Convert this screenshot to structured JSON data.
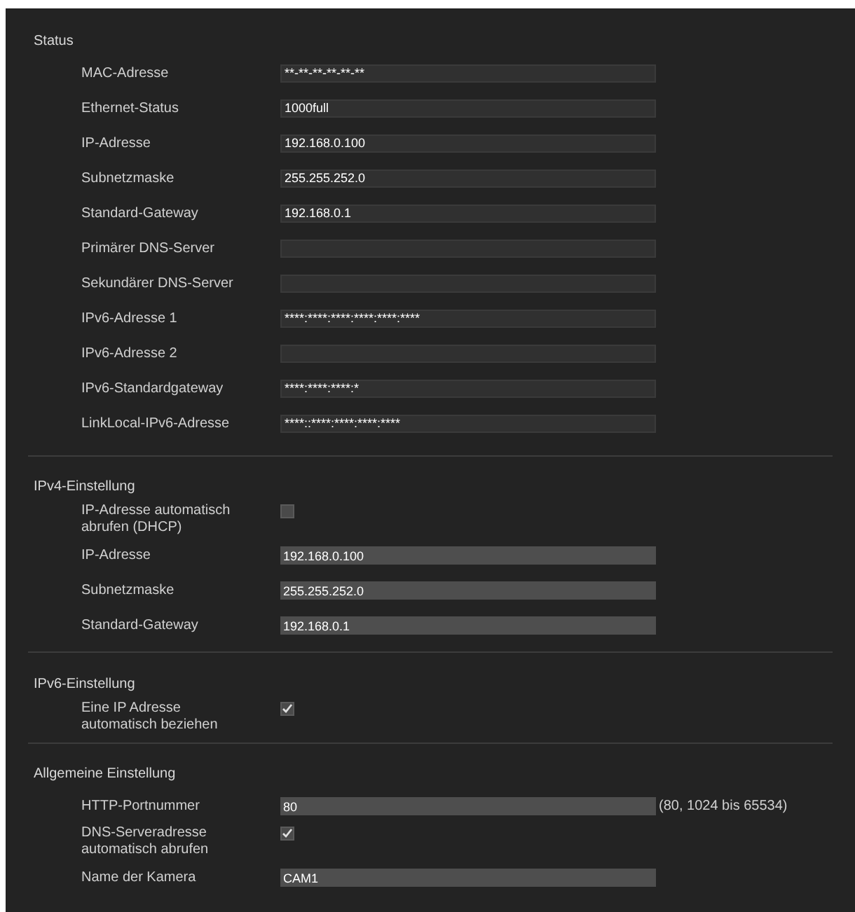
{
  "sections": [
    {
      "title": "Status",
      "rows": [
        {
          "kind": "readonly",
          "label": "MAC-Adresse",
          "value": "**-**-**-**-**-**"
        },
        {
          "kind": "readonly",
          "label": "Ethernet-Status",
          "value": "1000full"
        },
        {
          "kind": "readonly",
          "label": "IP-Adresse",
          "value": "192.168.0.100"
        },
        {
          "kind": "readonly",
          "label": "Subnetzmaske",
          "value": "255.255.252.0"
        },
        {
          "kind": "readonly",
          "label": "Standard-Gateway",
          "value": "192.168.0.1"
        },
        {
          "kind": "readonly",
          "label": "Primärer DNS-Server"
        },
        {
          "kind": "readonly",
          "label": "Sekundärer DNS-Server"
        },
        {
          "kind": "readonly",
          "label": "IPv6-Adresse 1",
          "value": "****:****:****:****:****:****"
        },
        {
          "kind": "readonly",
          "label": "IPv6-Adresse 2"
        },
        {
          "kind": "readonly",
          "label": "IPv6-Standardgateway",
          "value": "****:****:****:*"
        },
        {
          "kind": "readonly",
          "label": "LinkLocal-IPv6-Adresse",
          "value": "****::****:****:****:****"
        }
      ]
    },
    {
      "title": "IPv4-Einstellung",
      "rows": [
        {
          "kind": "checkbox",
          "label": "IP-Adresse automatisch abrufen (DHCP)",
          "checked": false
        },
        {
          "kind": "input",
          "label": "IP-Adresse",
          "value": "192.168.0.100"
        },
        {
          "kind": "input",
          "label": "Subnetzmaske",
          "value": "255.255.252.0"
        },
        {
          "kind": "input",
          "label": "Standard-Gateway",
          "value": "192.168.0.1"
        }
      ]
    },
    {
      "title": "IPv6-Einstellung",
      "rows": [
        {
          "kind": "checkbox",
          "label": "Eine IP Adresse automatisch beziehen",
          "checked": true
        }
      ]
    },
    {
      "title": "Allgemeine Einstellung",
      "rows": [
        {
          "kind": "input",
          "label": "HTTP-Portnummer",
          "value": "80",
          "hint": "(80, 1024 bis 65534)"
        },
        {
          "kind": "checkbox",
          "label": "DNS-Serveradresse automatisch abrufen",
          "checked": true
        },
        {
          "kind": "input",
          "label": "Name der Kamera",
          "value": "CAM1"
        }
      ]
    }
  ]
}
